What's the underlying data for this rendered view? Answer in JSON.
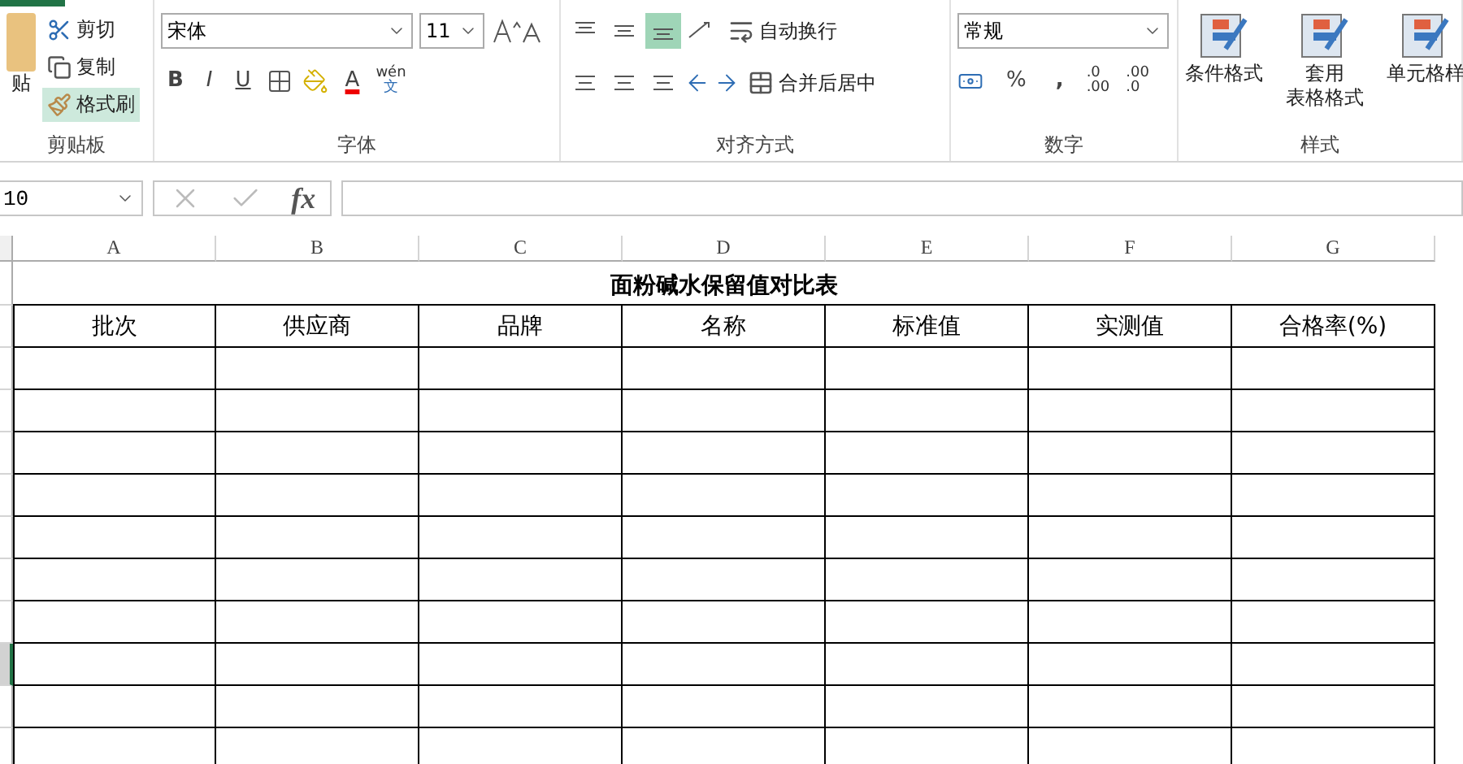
{
  "ribbon": {
    "groups": [
      {
        "kind": "clipboard",
        "label": "剪贴板",
        "paste": "贴",
        "cut": "剪切",
        "copy": "复制",
        "painter": {
          "label": "格式刷",
          "selected": true
        }
      },
      {
        "kind": "font",
        "label": "字体",
        "font_name": "宋体",
        "font_size": "11",
        "bold": "B",
        "italic": "I",
        "underline": "U",
        "font_color": "A",
        "phonetic": {
          "top": "wén",
          "bottom": "文"
        }
      },
      {
        "kind": "alignment",
        "label": "对齐方式",
        "vertical_align": [
          {
            "selected": false
          },
          {
            "selected": false
          },
          {
            "selected": true
          }
        ],
        "wrap": "自动换行",
        "merge": "合并后居中"
      },
      {
        "kind": "number",
        "label": "数字",
        "format": "常规",
        "percent": "%",
        "comma": ",",
        "increase_decimal": [
          ".0",
          ".00"
        ],
        "decrease_decimal": [
          ".00",
          ".0"
        ]
      },
      {
        "kind": "styles",
        "label": "样式",
        "conditional": "条件格式",
        "table_format": [
          "套用",
          "表格格式"
        ],
        "cell_styles": "单元格样"
      }
    ]
  },
  "formula_bar": {
    "name_box": "10",
    "fx": "fx"
  },
  "sheet": {
    "columns": [
      "A",
      "B",
      "C",
      "D",
      "E",
      "F",
      "G"
    ],
    "title": "面粉碱水保留值对比表",
    "headers": [
      "批次",
      "供应商",
      "品牌",
      "名称",
      "标准值",
      "实测值",
      "合格率(%)"
    ],
    "rows": [
      {
        "selected": false
      },
      {
        "selected": false
      },
      {
        "selected": false
      },
      {
        "selected": false
      },
      {
        "selected": false
      },
      {
        "selected": false
      },
      {
        "selected": false
      },
      {
        "selected": true
      },
      {
        "selected": false
      },
      {
        "selected": false
      }
    ]
  }
}
